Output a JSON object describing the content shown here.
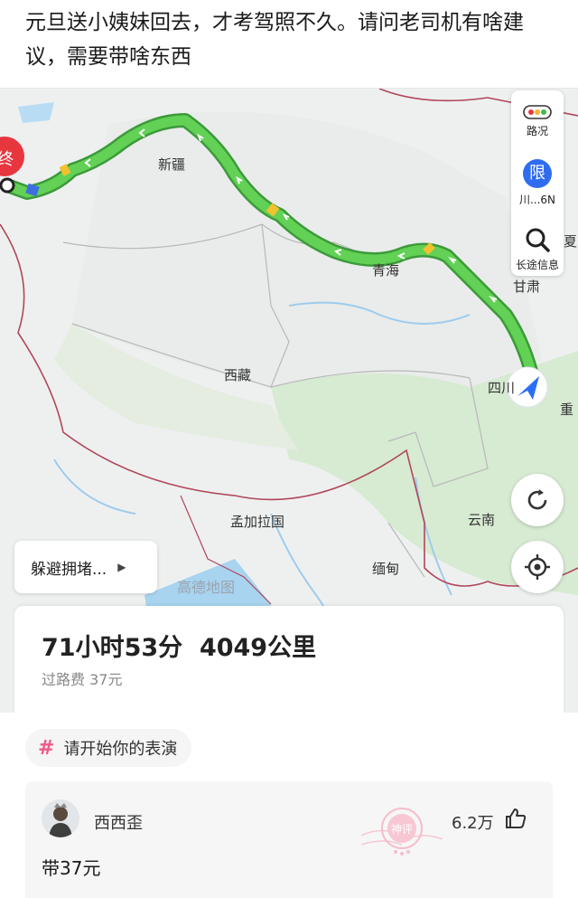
{
  "post": {
    "title": "元旦送小姨妹回去，才考驾照不久。请问老司机有啥建议，需要带啥东西"
  },
  "map": {
    "end_marker": "终",
    "places": [
      "新疆",
      "青海",
      "西藏",
      "四川",
      "重",
      "甘肃",
      "孟加拉国",
      "云南",
      "缅甸",
      "夏"
    ],
    "watermark": "高德地图",
    "controls": {
      "traffic_label": "路况",
      "restrict_badge": "限",
      "restrict_label": "川...6N",
      "search_label": "长途信息"
    },
    "avoid_button": "躲避拥堵...",
    "route_color": "#5cc54f"
  },
  "route": {
    "summary": "71小时53分  4049公里",
    "toll": "过路费 37元"
  },
  "topic": {
    "label": "请开始你的表演"
  },
  "comment": {
    "username": "西西歪",
    "text": "带37元",
    "likes": "6.2万",
    "stamp_text": "神评"
  }
}
